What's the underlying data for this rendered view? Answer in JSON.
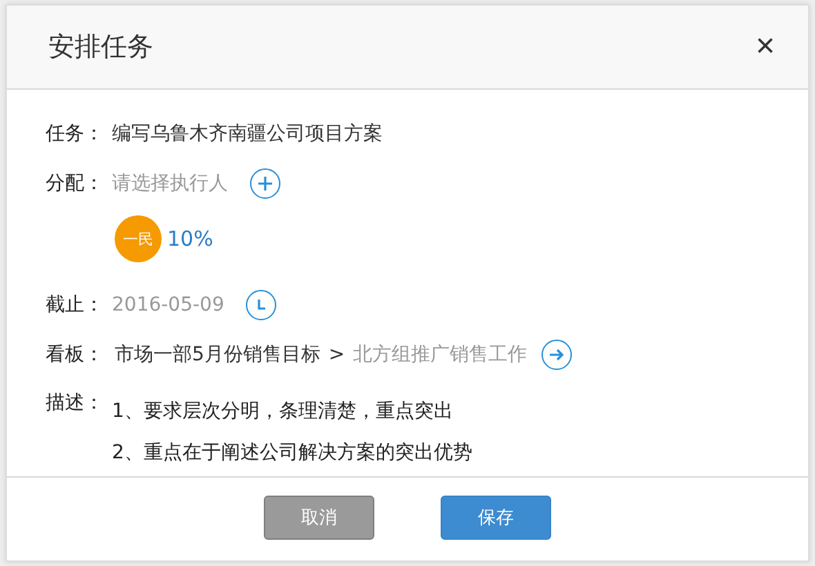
{
  "title": "安排任务",
  "close": "×",
  "task": {
    "label": "任务：",
    "value": "编写乌鲁木齐南疆公司项目方案"
  },
  "assign": {
    "label": "分配：",
    "placeholder": "请选择执行人"
  },
  "assignees": [
    {
      "initials": "一民",
      "color": "#f59a00",
      "progress": "10%"
    }
  ],
  "deadline": {
    "label": "截止：",
    "value": "2016-05-09"
  },
  "board": {
    "label": "看板：",
    "parent": "市场一部5月份销售目标",
    "separator": ">",
    "current": "北方组推广销售工作"
  },
  "description": {
    "label": "描述：",
    "lines": [
      "1、要求层次分明，条理清楚，重点突出",
      "2、重点在于阐述公司解决方案的突出优势"
    ]
  },
  "buttons": [
    {
      "kind": "secondary",
      "label": "取消"
    },
    {
      "kind": "primary",
      "label": "保存"
    }
  ]
}
